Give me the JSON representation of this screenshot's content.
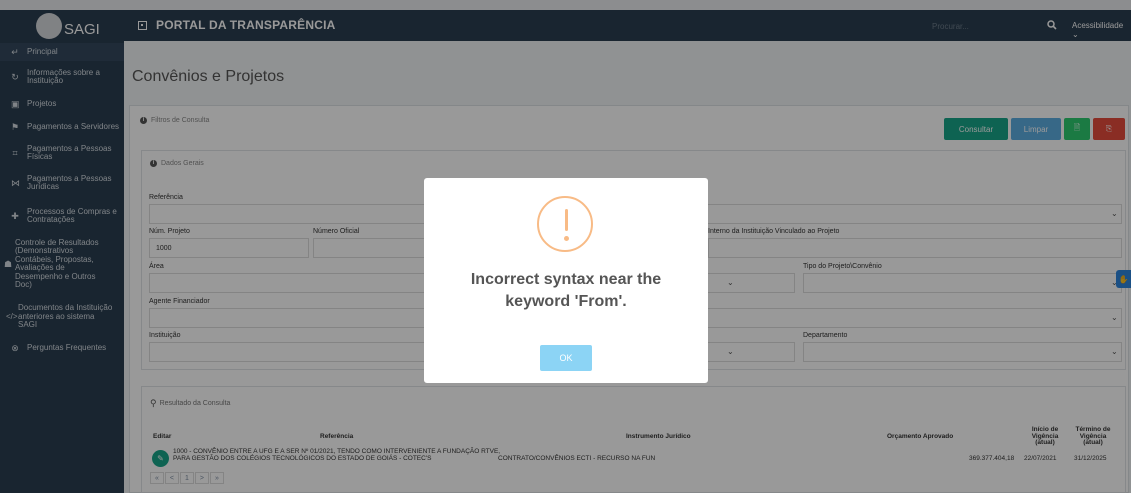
{
  "header": {
    "logo_text": "SAGI",
    "portal_title": "PORTAL DA TRANSPARÊNCIA",
    "search_placeholder": "Procurar...",
    "accessibility": "Acessibilidade"
  },
  "sidebar": {
    "items": [
      {
        "label": "Principal",
        "icon": "return-icon"
      },
      {
        "label": "Informações sobre a Instituição",
        "icon": "refresh-icon"
      },
      {
        "label": "Projetos",
        "icon": "square-icon"
      },
      {
        "label": "Pagamentos a Servidores",
        "icon": "flag-icon"
      },
      {
        "label": "Pagamentos a Pessoas Físicas",
        "icon": "cube-icon"
      },
      {
        "label": "Pagamentos a Pessoas Jurídicas",
        "icon": "network-icon"
      },
      {
        "label": "Processos de Compras e Contratações",
        "icon": "plus-icon"
      },
      {
        "label": "Controle de Resultados (Demonstrativos Contábeis, Propostas, Avaliações de Desempenho e Outros Doc)",
        "icon": "hat-icon"
      },
      {
        "label": "Documentos da Instituição anteriores ao sistema SAGI",
        "icon": "code-icon"
      },
      {
        "label": "Perguntas Frequentes",
        "icon": "help-circle-icon"
      }
    ]
  },
  "main": {
    "page_title": "Convênios e Projetos",
    "filters_title": "Filtros de Consulta",
    "buttons": {
      "consultar": "Consultar",
      "limpar": "Limpar"
    },
    "general_title": "Dados Gerais",
    "fields": {
      "referencia": "Referência",
      "num_projeto": "Núm. Projeto",
      "num_projeto_value": "1000",
      "numero_oficial": "Número Oficial",
      "interno": "Interno da Instituição Vinculado ao Projeto",
      "area": "Área",
      "tipo": "Tipo do Projeto\\Convênio",
      "agente": "Agente Financiador",
      "instituicao": "Instituição",
      "departamento": "Departamento"
    },
    "results": {
      "title": "Resultado da Consulta",
      "headers": {
        "editar": "Editar",
        "referencia": "Referência",
        "instrumento": "Instrumento Jurídico",
        "orcamento": "Orçamento Aprovado",
        "inicio": "Início de Vigência (atual)",
        "termino": "Término de Vigência (atual)"
      },
      "row": {
        "referencia": "1000 - CONVÊNIO ENTRE A UFG E A SER Nº 01/2021, TENDO COMO INTERVENIENTE A FUNDAÇÃO RTVE, PARA GESTÃO DOS COLÉGIOS TECNOLÓGICOS DO ESTADO DE GOIÁS - COTEC'S",
        "instrumento": "CONTRATO/CONVÊNIOS ECTI - RECURSO NA FUN",
        "orcamento": "369.377.404,18",
        "inicio": "22/07/2021",
        "termino": "31/12/2025"
      },
      "pager": [
        "«",
        "<",
        "1",
        ">",
        "»"
      ]
    }
  },
  "modal": {
    "message": "Incorrect syntax near the keyword 'From'.",
    "ok_label": "OK"
  }
}
